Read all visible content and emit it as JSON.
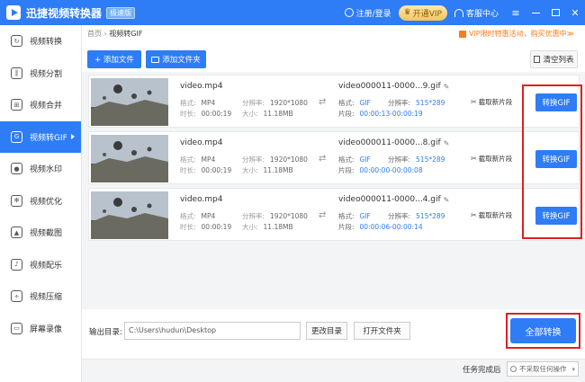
{
  "titlebar": {
    "app_title": "迅捷视频转换器",
    "edition": "极速版",
    "login": "注册/登录",
    "vip": "开通VIP",
    "service": "客服中心",
    "minimize": "—",
    "close": "✕"
  },
  "sidebar": {
    "items": [
      {
        "label": "视频转换",
        "icon": "video-convert-icon"
      },
      {
        "label": "视频分割",
        "icon": "video-split-icon"
      },
      {
        "label": "视频合并",
        "icon": "video-merge-icon"
      },
      {
        "label": "视频转GIF",
        "icon": "gif-icon",
        "active": true
      },
      {
        "label": "视频水印",
        "icon": "watermark-icon"
      },
      {
        "label": "视频优化",
        "icon": "optimize-icon"
      },
      {
        "label": "视频截图",
        "icon": "screenshot-icon"
      },
      {
        "label": "视频配乐",
        "icon": "music-icon"
      },
      {
        "label": "视频压缩",
        "icon": "compress-icon"
      },
      {
        "label": "屏幕录像",
        "icon": "screen-record-icon"
      }
    ]
  },
  "breadcrumb": {
    "home": "首页",
    "sep": " › ",
    "current": "视频转GIF"
  },
  "promo": "VIP限时特惠活动，购买优惠中≫",
  "toolbar": {
    "add_file": "+ 添加文件",
    "add_folder": "添加文件夹",
    "clear_list": "清空列表"
  },
  "files": [
    {
      "name": "video.mp4",
      "format_label": "格式:",
      "format": "MP4",
      "res_label": "分辨率:",
      "resolution": "1920*1080",
      "duration_label": "时长:",
      "duration": "00:00:19",
      "size_label": "大小:",
      "size": "11.18MB",
      "output_name": "video000011-0000...9.gif",
      "out_format_label": "格式:",
      "out_format": "GIF",
      "out_res_label": "分辨率:",
      "out_resolution": "515*289",
      "clip_label": "片段:",
      "clip": "00:00:13-00:00:19",
      "cut_label": "截取新片段",
      "convert_label": "转换GIF"
    },
    {
      "name": "video.mp4",
      "format_label": "格式:",
      "format": "MP4",
      "res_label": "分辨率:",
      "resolution": "1920*1080",
      "duration_label": "时长:",
      "duration": "00:00:19",
      "size_label": "大小:",
      "size": "11.18MB",
      "output_name": "video000011-0000...8.gif",
      "out_format_label": "格式:",
      "out_format": "GIF",
      "out_res_label": "分辨率:",
      "out_resolution": "515*289",
      "clip_label": "片段:",
      "clip": "00:00:00-00:00:08",
      "cut_label": "截取新片段",
      "convert_label": "转换GIF"
    },
    {
      "name": "video.mp4",
      "format_label": "格式:",
      "format": "MP4",
      "res_label": "分辨率:",
      "resolution": "1920*1080",
      "duration_label": "时长:",
      "duration": "00:00:19",
      "size_label": "大小:",
      "size": "11.18MB",
      "output_name": "video000011-0000...4.gif",
      "out_format_label": "格式:",
      "out_format": "GIF",
      "out_res_label": "分辨率:",
      "out_resolution": "515*289",
      "clip_label": "片段:",
      "clip": "00:00:06-00:00:14",
      "cut_label": "截取新片段",
      "convert_label": "转换GIF"
    }
  ],
  "bottom": {
    "output_label": "输出目录:",
    "output_path": "C:\\Users\\hudun\\Desktop",
    "change_dir": "更改目录",
    "open_folder": "打开文件夹",
    "convert_all": "全部转换"
  },
  "footer": {
    "after_label": "任务完成后",
    "after_value": "不采取任何操作"
  },
  "colors": {
    "accent": "#2e7cf6",
    "highlight": "#e02020",
    "promo": "#ff7a1a"
  }
}
